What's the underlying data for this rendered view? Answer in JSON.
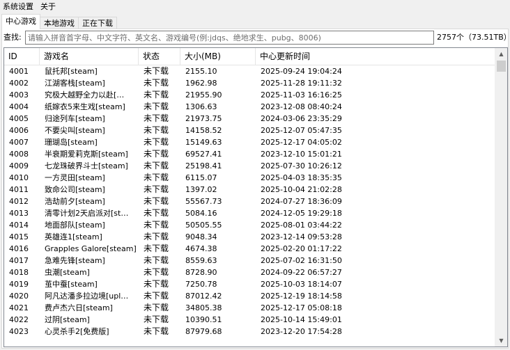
{
  "menu": {
    "settings": "系统设置",
    "about": "关于"
  },
  "tabs": [
    {
      "label": "中心游戏",
      "active": true
    },
    {
      "label": "本地游戏",
      "active": false
    },
    {
      "label": "正在下载",
      "active": false
    }
  ],
  "search": {
    "label": "查找:",
    "placeholder": "请输入拼音首字母、中文字符、英文名、游戏编号(例:jdqs、绝地求生、pubg、8006)",
    "value": ""
  },
  "summary": "2757个（73.51TB）",
  "columns": [
    "ID",
    "游戏名",
    "状态",
    "大小(MB)",
    "中心更新时间"
  ],
  "rows": [
    [
      "4001",
      "鼠托邦[steam]",
      "未下载",
      "2155.10",
      "2025-09-24 19:04:24"
    ],
    [
      "4002",
      "江湖客栈[steam]",
      "未下载",
      "1962.98",
      "2025-11-28 19:11:32"
    ],
    [
      "4003",
      "究极大越野全力以赴[…",
      "未下载",
      "21955.90",
      "2025-11-03 16:16:25"
    ],
    [
      "4004",
      "纸嫁衣5来生戏[steam]",
      "未下载",
      "1306.63",
      "2023-12-08 08:40:24"
    ],
    [
      "4005",
      "归途列车[steam]",
      "未下载",
      "21973.75",
      "2024-03-06 23:35:29"
    ],
    [
      "4006",
      "不要尖叫[steam]",
      "未下载",
      "14158.52",
      "2025-12-07 05:47:35"
    ],
    [
      "4007",
      "珊瑚岛[steam]",
      "未下载",
      "15149.63",
      "2025-12-17 04:05:02"
    ],
    [
      "4008",
      "半衰期爱莉克斯[steam]",
      "未下载",
      "69527.41",
      "2023-12-10 15:01:21"
    ],
    [
      "4009",
      "七龙珠破界斗士[steam]",
      "未下载",
      "25198.41",
      "2025-07-30 10:26:12"
    ],
    [
      "4010",
      "一方灵田[steam]",
      "未下载",
      "6115.07",
      "2025-04-03 18:35:35"
    ],
    [
      "4011",
      "致命公司[steam]",
      "未下载",
      "1397.02",
      "2025-10-04 21:02:28"
    ],
    [
      "4012",
      "浩劫前夕[steam]",
      "未下载",
      "55567.73",
      "2024-07-27 18:36:09"
    ],
    [
      "4013",
      "清零计划2天启派对[st…",
      "未下载",
      "5084.16",
      "2024-12-05 19:29:18"
    ],
    [
      "4014",
      "地面部队[steam]",
      "未下载",
      "50505.55",
      "2025-08-01 03:44:22"
    ],
    [
      "4015",
      "英雄连1[steam]",
      "未下载",
      "9048.34",
      "2023-12-14 09:53:28"
    ],
    [
      "4016",
      "Grapples Galore[steam]",
      "未下载",
      "4674.38",
      "2025-02-20 01:17:22"
    ],
    [
      "4017",
      "急难先锋[steam]",
      "未下载",
      "8559.63",
      "2025-07-02 16:31:50"
    ],
    [
      "4018",
      "虫潮[steam]",
      "未下载",
      "8728.90",
      "2024-09-22 06:57:27"
    ],
    [
      "4019",
      "茧中蚕[steam]",
      "未下载",
      "7250.78",
      "2025-10-03 18:14:07"
    ],
    [
      "4020",
      "阿凡达潘多拉边境[upl…",
      "未下载",
      "87012.42",
      "2025-12-19 18:14:58"
    ],
    [
      "4021",
      "费卢杰六日[steam]",
      "未下载",
      "34805.38",
      "2025-12-17 05:08:18"
    ],
    [
      "4022",
      "过阴[steam]",
      "未下载",
      "10390.51",
      "2025-10-14 15:49:01"
    ],
    [
      "4023",
      "心灵杀手2[免费版]",
      "未下载",
      "87979.68",
      "2023-12-20 17:54:28"
    ]
  ],
  "icons": {
    "scroll_up": "scroll-up-arrow-icon",
    "scroll_down": "scroll-down-arrow-icon"
  }
}
